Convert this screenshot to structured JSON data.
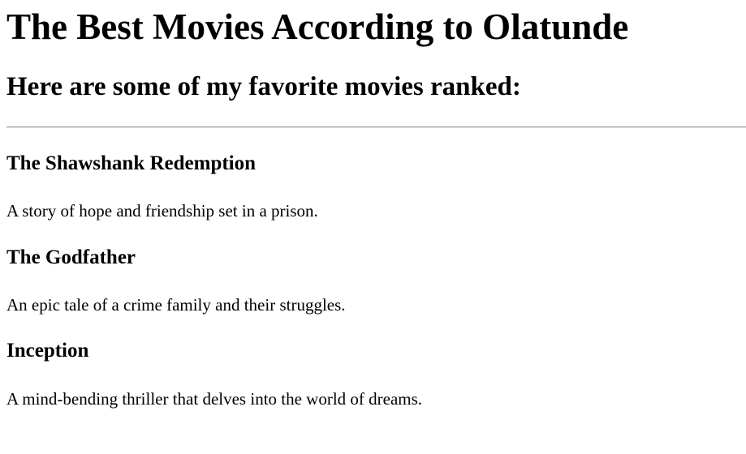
{
  "page": {
    "title": "The Best Movies According to Olatunde",
    "subtitle": "Here are some of my favorite movies ranked:"
  },
  "movies": [
    {
      "title": "The Shawshank Redemption",
      "description": "A story of hope and friendship set in a prison."
    },
    {
      "title": "The Godfather",
      "description": "An epic tale of a crime family and their struggles."
    },
    {
      "title": "Inception",
      "description": "A mind-bending thriller that delves into the world of dreams."
    }
  ]
}
